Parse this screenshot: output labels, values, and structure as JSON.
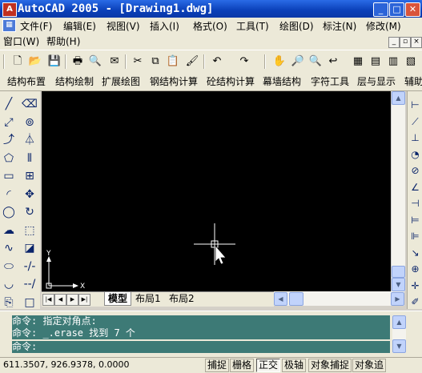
{
  "window": {
    "title": "AutoCAD 2005 - [Drawing1.dwg]",
    "minimize_glyph": "_",
    "maximize_glyph": "□",
    "close_glyph": "✕"
  },
  "menu": {
    "row1": [
      "文件(F)",
      "编辑(E)",
      "视图(V)",
      "插入(I)",
      "格式(O)",
      "工具(T)",
      "绘图(D)",
      "标注(N)",
      "修改(M)"
    ],
    "row2": [
      "窗口(W)",
      "帮助(H)"
    ]
  },
  "structure_menu": [
    "结构布置",
    "结构绘制",
    "扩展绘图",
    "钢结构计算",
    "砼结构计算",
    "幕墙结构",
    "字符工具",
    "层与显示",
    "辅助"
  ],
  "standard_toolbar": [
    {
      "icon": "new-icon",
      "glyph": "🗋"
    },
    {
      "icon": "open-icon",
      "glyph": "📂"
    },
    {
      "icon": "save-icon",
      "glyph": "💾"
    },
    {
      "icon": "print-icon",
      "glyph": "🖶"
    },
    {
      "icon": "print-preview-icon",
      "glyph": "🔍"
    },
    {
      "icon": "publish-icon",
      "glyph": "✉"
    },
    {
      "icon": "cut-icon",
      "glyph": "✂"
    },
    {
      "icon": "copy-icon",
      "glyph": "⧉"
    },
    {
      "icon": "paste-icon",
      "glyph": "📋"
    },
    {
      "icon": "match-properties-icon",
      "glyph": "🖌"
    },
    {
      "icon": "undo-icon",
      "glyph": "↶"
    },
    {
      "icon": "redo-icon",
      "glyph": "↷"
    },
    {
      "icon": "pan-icon",
      "glyph": "✋"
    },
    {
      "icon": "zoom-realtime-icon",
      "glyph": "🔎"
    },
    {
      "icon": "zoom-window-icon",
      "glyph": "🔍"
    },
    {
      "icon": "zoom-previous-icon",
      "glyph": "↩"
    },
    {
      "icon": "properties-icon",
      "glyph": "▦"
    },
    {
      "icon": "design-center-icon",
      "glyph": "▤"
    },
    {
      "icon": "tool-palettes-icon",
      "glyph": "▥"
    },
    {
      "icon": "sheet-set-icon",
      "glyph": "▧"
    },
    {
      "icon": "markup-icon",
      "glyph": "✎"
    }
  ],
  "draw_toolbar": [
    {
      "icon": "line-icon",
      "glyph": "╱"
    },
    {
      "icon": "construction-line-icon",
      "glyph": "⤢"
    },
    {
      "icon": "polyline-icon",
      "glyph": "⤴"
    },
    {
      "icon": "polygon-icon",
      "glyph": "⬠"
    },
    {
      "icon": "rectangle-icon",
      "glyph": "▭"
    },
    {
      "icon": "arc-icon",
      "glyph": "◜"
    },
    {
      "icon": "circle-icon",
      "glyph": "◯"
    },
    {
      "icon": "revision-cloud-icon",
      "glyph": "☁"
    },
    {
      "icon": "spline-icon",
      "glyph": "∿"
    },
    {
      "icon": "ellipse-icon",
      "glyph": "⬭"
    },
    {
      "icon": "ellipse-arc-icon",
      "glyph": "◡"
    },
    {
      "icon": "insert-block-icon",
      "glyph": "⎘"
    }
  ],
  "modify_toolbar": [
    {
      "icon": "erase-icon",
      "glyph": "⌫"
    },
    {
      "icon": "copy-object-icon",
      "glyph": "⊚"
    },
    {
      "icon": "mirror-icon",
      "glyph": "⏃"
    },
    {
      "icon": "offset-icon",
      "glyph": "⫴"
    },
    {
      "icon": "array-icon",
      "glyph": "⊞"
    },
    {
      "icon": "move-icon",
      "glyph": "✥"
    },
    {
      "icon": "rotate-icon",
      "glyph": "↻"
    },
    {
      "icon": "scale-icon",
      "glyph": "⬚"
    },
    {
      "icon": "stretch-icon",
      "glyph": "◪"
    },
    {
      "icon": "trim-icon",
      "glyph": "-/-"
    },
    {
      "icon": "extend-icon",
      "glyph": "--/"
    },
    {
      "icon": "break-icon",
      "glyph": "□"
    }
  ],
  "dimension_toolbar": [
    {
      "icon": "linear-dim-icon",
      "glyph": "⊢"
    },
    {
      "icon": "aligned-dim-icon",
      "glyph": "⟋"
    },
    {
      "icon": "ordinate-dim-icon",
      "glyph": "⊥"
    },
    {
      "icon": "radius-dim-icon",
      "glyph": "◔"
    },
    {
      "icon": "diameter-dim-icon",
      "glyph": "⊘"
    },
    {
      "icon": "angular-dim-icon",
      "glyph": "∠"
    },
    {
      "icon": "quick-dim-icon",
      "glyph": "⊣"
    },
    {
      "icon": "baseline-dim-icon",
      "glyph": "⊨"
    },
    {
      "icon": "continue-dim-icon",
      "glyph": "⊫"
    },
    {
      "icon": "leader-icon",
      "glyph": "↘"
    },
    {
      "icon": "tolerance-icon",
      "glyph": "⊕"
    },
    {
      "icon": "center-mark-icon",
      "glyph": "✛"
    },
    {
      "icon": "dim-edit-icon",
      "glyph": "✐"
    }
  ],
  "layout_tabs": [
    "模型",
    "布局1",
    "布局2"
  ],
  "ucs": {
    "x_label": "X",
    "y_label": "Y"
  },
  "command": {
    "history": [
      "命令: 指定对角点:",
      "命令: _.erase 找到 7 个"
    ],
    "prompt": "命令:"
  },
  "status": {
    "coords": "611.3507, 926.9378, 0.0000",
    "buttons": [
      {
        "label": "捕捉",
        "on": false
      },
      {
        "label": "栅格",
        "on": false
      },
      {
        "label": "正交",
        "on": true
      },
      {
        "label": "极轴",
        "on": false
      },
      {
        "label": "对象捕捉",
        "on": false
      },
      {
        "label": "对象追",
        "on": false
      }
    ]
  },
  "colors": {
    "canvas": "#000000",
    "command_bg": "#3d7a76",
    "titlebar": "#0a3fb8"
  }
}
